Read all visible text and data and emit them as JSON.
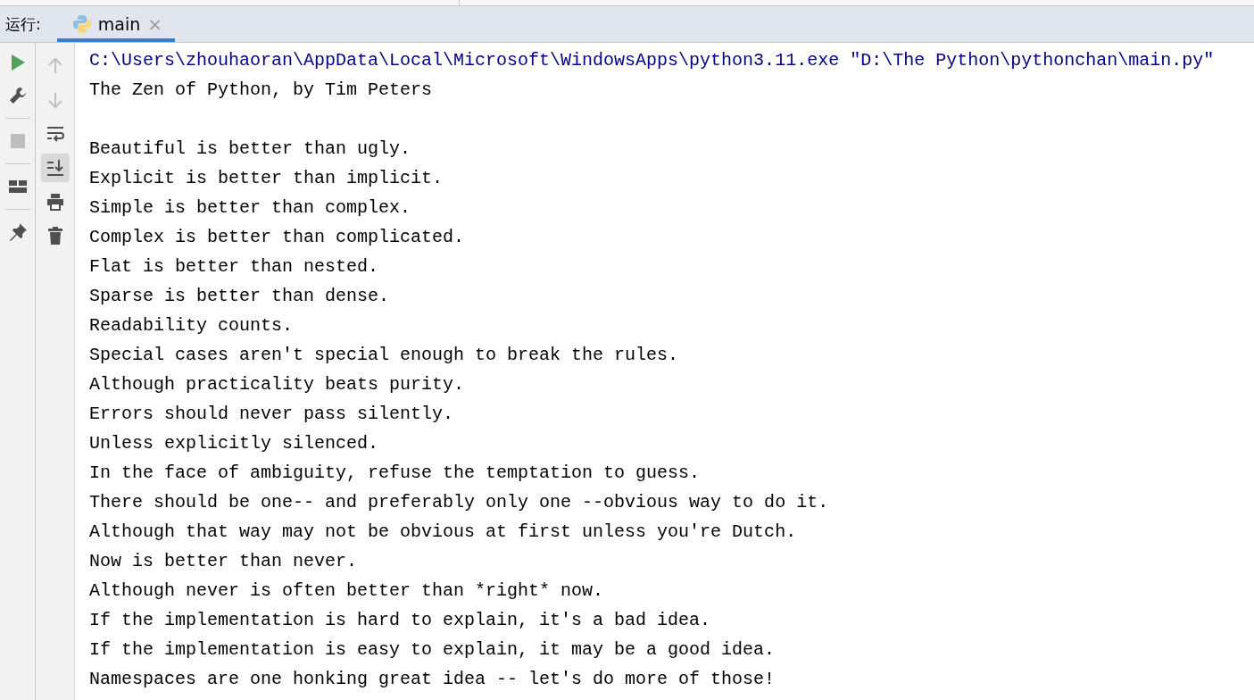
{
  "run_panel": {
    "label": "运行:",
    "tabs": [
      {
        "label": "main",
        "selected": true,
        "close": "×"
      }
    ]
  },
  "left_toolbar": [
    {
      "kind": "run",
      "disabled": false
    },
    {
      "kind": "wrench",
      "disabled": false
    },
    {
      "kind": "stop",
      "disabled": true
    },
    {
      "kind": "layout",
      "disabled": false
    },
    {
      "kind": "pin",
      "disabled": false
    }
  ],
  "console_toolbar": [
    {
      "kind": "up",
      "disabled": true,
      "selected": false
    },
    {
      "kind": "down",
      "disabled": true,
      "selected": false
    },
    {
      "kind": "wrap",
      "disabled": false,
      "selected": false
    },
    {
      "kind": "scroll-end",
      "disabled": false,
      "selected": true
    },
    {
      "kind": "print",
      "disabled": false,
      "selected": false
    },
    {
      "kind": "trash",
      "disabled": false,
      "selected": false
    }
  ],
  "console": [
    {
      "kind": "command",
      "text": "C:\\Users\\zhouhaoran\\AppData\\Local\\Microsoft\\WindowsApps\\python3.11.exe \"D:\\The Python\\pythonchan\\main.py\""
    },
    {
      "kind": "output",
      "text": "The Zen of Python, by Tim Peters"
    },
    {
      "kind": "blank"
    },
    {
      "kind": "output",
      "text": "Beautiful is better than ugly."
    },
    {
      "kind": "output",
      "text": "Explicit is better than implicit."
    },
    {
      "kind": "output",
      "text": "Simple is better than complex."
    },
    {
      "kind": "output",
      "text": "Complex is better than complicated."
    },
    {
      "kind": "output",
      "text": "Flat is better than nested."
    },
    {
      "kind": "output",
      "text": "Sparse is better than dense."
    },
    {
      "kind": "output",
      "text": "Readability counts."
    },
    {
      "kind": "output",
      "text": "Special cases aren't special enough to break the rules."
    },
    {
      "kind": "output",
      "text": "Although practicality beats purity."
    },
    {
      "kind": "output",
      "text": "Errors should never pass silently."
    },
    {
      "kind": "output",
      "text": "Unless explicitly silenced."
    },
    {
      "kind": "output",
      "text": "In the face of ambiguity, refuse the temptation to guess."
    },
    {
      "kind": "output",
      "text": "There should be one-- and preferably only one --obvious way to do it."
    },
    {
      "kind": "output",
      "text": "Although that way may not be obvious at first unless you're Dutch."
    },
    {
      "kind": "output",
      "text": "Now is better than never."
    },
    {
      "kind": "output",
      "text": "Although never is often better than *right* now."
    },
    {
      "kind": "output",
      "text": "If the implementation is hard to explain, it's a bad idea."
    },
    {
      "kind": "output",
      "text": "If the implementation is easy to explain, it may be a good idea."
    },
    {
      "kind": "output",
      "text": "Namespaces are one honking great idea -- let's do more of those!"
    }
  ]
}
